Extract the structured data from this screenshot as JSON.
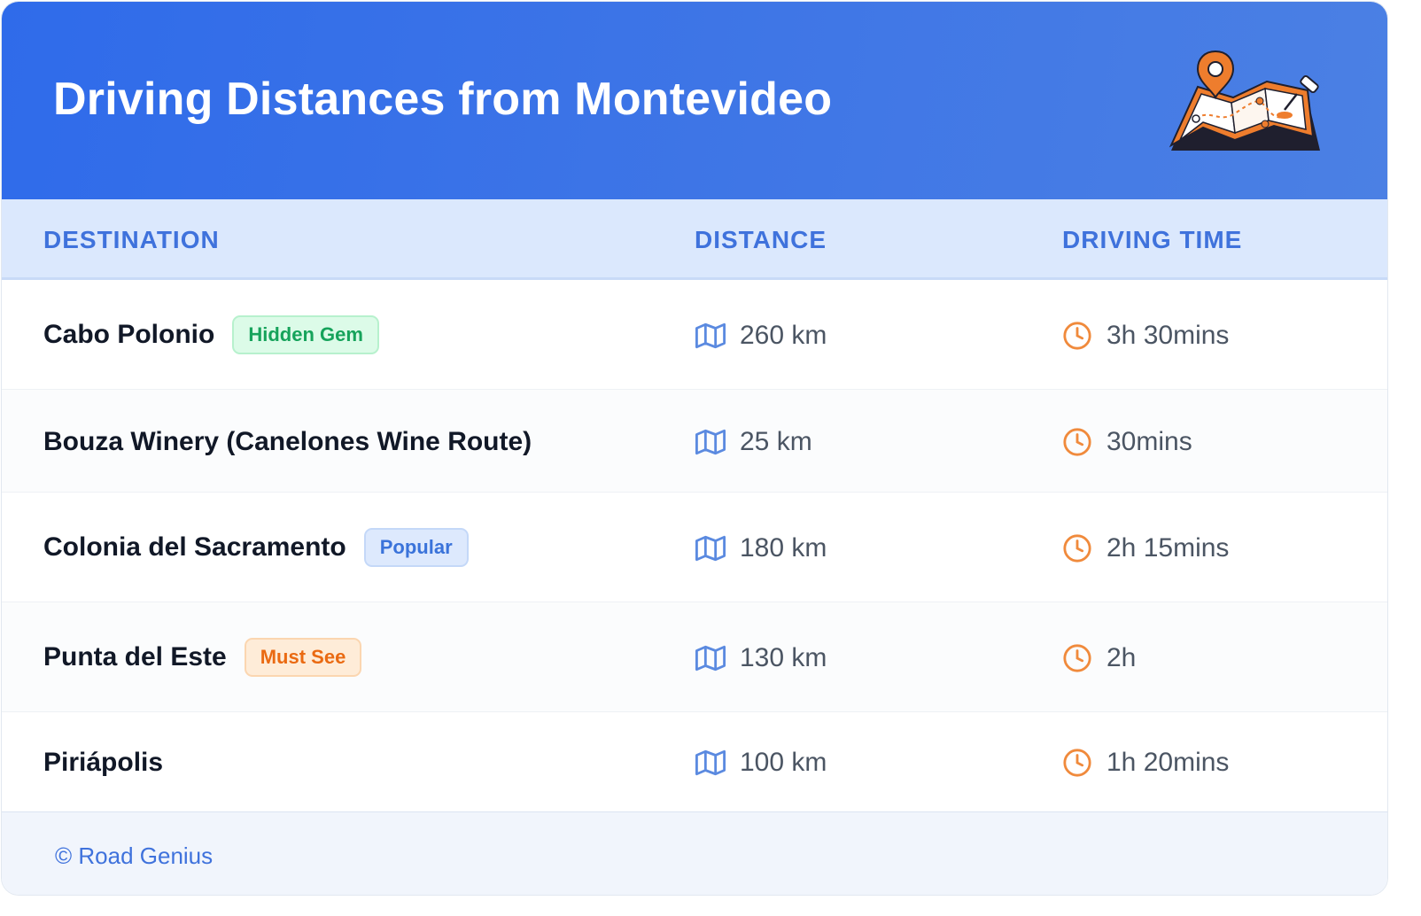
{
  "header": {
    "title": "Driving Distances from Montevideo",
    "icon": "folded-map-with-pins-icon"
  },
  "table": {
    "columns": [
      "DESTINATION",
      "DISTANCE",
      "DRIVING TIME"
    ],
    "rows": [
      {
        "destination": "Cabo Polonio",
        "badge": "Hidden Gem",
        "badge_color": "#16a35b",
        "distance": "260 km",
        "time": "3h 30mins"
      },
      {
        "destination": "Bouza Winery (Canelones Wine Route)",
        "badge": "",
        "distance": "25 km",
        "time": "30mins"
      },
      {
        "destination": "Colonia del Sacramento",
        "badge": "Popular",
        "badge_color": "#3a73da",
        "distance": "180 km",
        "time": "2h 15mins"
      },
      {
        "destination": "Punta del Este",
        "badge": "Must See",
        "badge_color": "#ea6a12",
        "distance": "130 km",
        "time": "2h"
      },
      {
        "destination": "Piriápolis",
        "badge": "",
        "distance": "100 km",
        "time": "1h 20mins"
      }
    ]
  },
  "footer": {
    "text": "© Road Genius"
  },
  "colors": {
    "header_blue": "#2f6bea",
    "accent_blue": "#3f72dc",
    "accent_orange": "#f08a3c"
  }
}
